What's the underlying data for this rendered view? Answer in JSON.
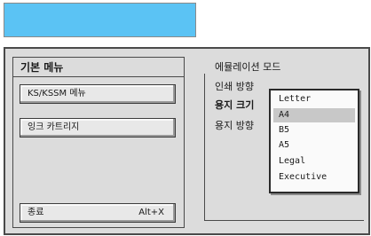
{
  "colors": {
    "banner": "#5bc3f4",
    "panel": "#dcdcdc",
    "selected_option": "#c8c8c8"
  },
  "left_pane": {
    "title": "기본 메뉴",
    "buttons": [
      {
        "label": "KS/KSSM 메뉴"
      },
      {
        "label": "잉크 카트리지"
      },
      {
        "label": "종료",
        "accelerator": "Alt+X"
      }
    ]
  },
  "right_pane": {
    "items": [
      "에뮬레이션 모드",
      "인쇄 방향",
      "용지 크기",
      "용지 방향"
    ]
  },
  "paper_size_dropdown": {
    "selected": "A4",
    "options": [
      "Letter",
      "A4",
      "B5",
      "A5",
      "Legal",
      "Executive"
    ]
  }
}
